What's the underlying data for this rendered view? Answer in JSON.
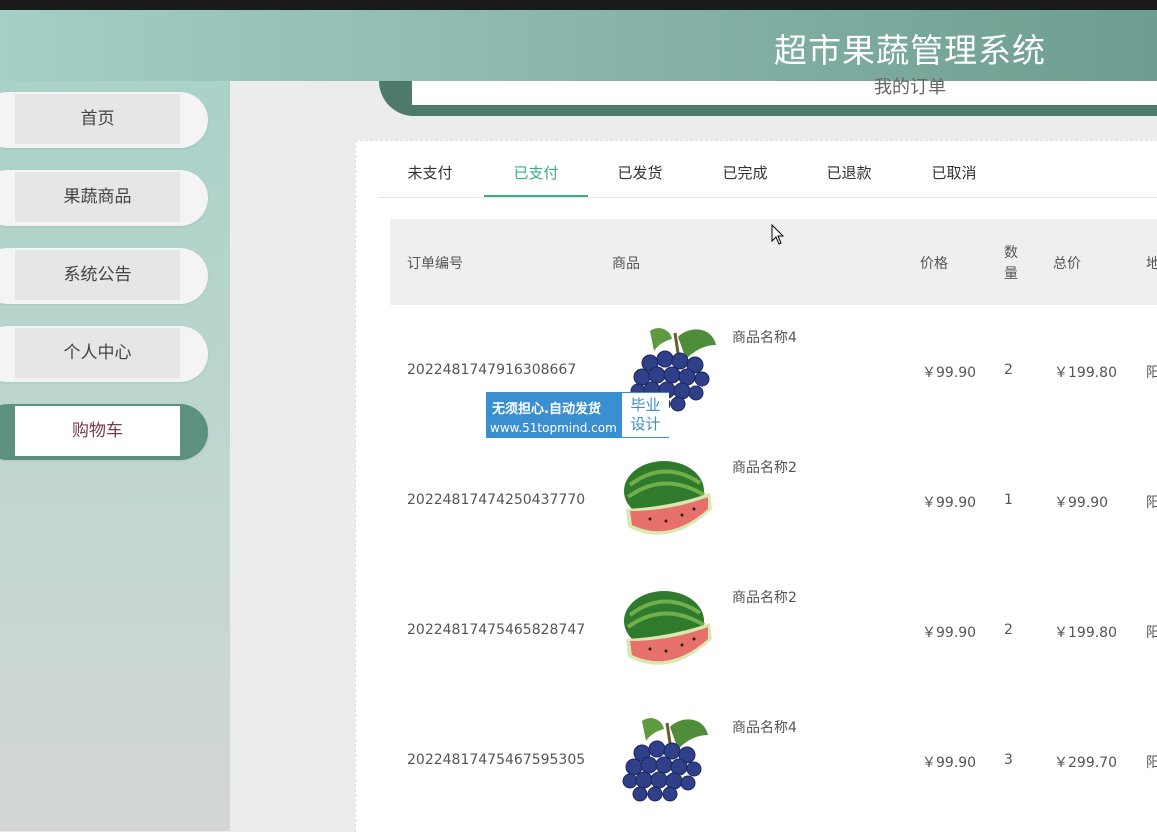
{
  "app": {
    "title": "超市果蔬管理系统"
  },
  "sidebar": {
    "items": [
      {
        "label": "首页",
        "active": false
      },
      {
        "label": "果蔬商品",
        "active": false
      },
      {
        "label": "系统公告",
        "active": false
      },
      {
        "label": "个人中心",
        "active": false
      },
      {
        "label": "购物车",
        "active": true
      }
    ]
  },
  "page": {
    "section_label": "我的订单"
  },
  "tabs": [
    {
      "label": "未支付",
      "active": false
    },
    {
      "label": "已支付",
      "active": true
    },
    {
      "label": "已发货",
      "active": false
    },
    {
      "label": "已完成",
      "active": false
    },
    {
      "label": "已退款",
      "active": false
    },
    {
      "label": "已取消",
      "active": false
    }
  ],
  "table": {
    "headers": {
      "order_no": "订单编号",
      "goods": "商品",
      "price": "价格",
      "qty_1": "数",
      "qty_2": "量",
      "total": "总价",
      "address": "地"
    },
    "rows": [
      {
        "order_no": "2022481747916308667",
        "goods_name": "商品名称4",
        "image": "grapes",
        "price": "￥99.90",
        "qty": "2",
        "total": "￥199.80",
        "address": "阳"
      },
      {
        "order_no": "20224817474250437770",
        "goods_name": "商品名称2",
        "image": "watermelon",
        "price": "￥99.90",
        "qty": "1",
        "total": "￥99.90",
        "address": "阳"
      },
      {
        "order_no": "20224817475465828747",
        "goods_name": "商品名称2",
        "image": "watermelon",
        "price": "￥99.90",
        "qty": "2",
        "total": "￥199.80",
        "address": "阳"
      },
      {
        "order_no": "20224817475467595305",
        "goods_name": "商品名称4",
        "image": "grapes",
        "price": "￥99.90",
        "qty": "3",
        "total": "￥299.70",
        "address": "阳"
      }
    ]
  },
  "watermark": {
    "line1": "无须担心.自动发货",
    "line2": "www.51topmind.com",
    "right_1": "毕业",
    "right_2": "设计"
  },
  "colors": {
    "accent": "#3aae88",
    "sidebar_active": "#5e907f",
    "active_text": "#7b3a4a"
  }
}
